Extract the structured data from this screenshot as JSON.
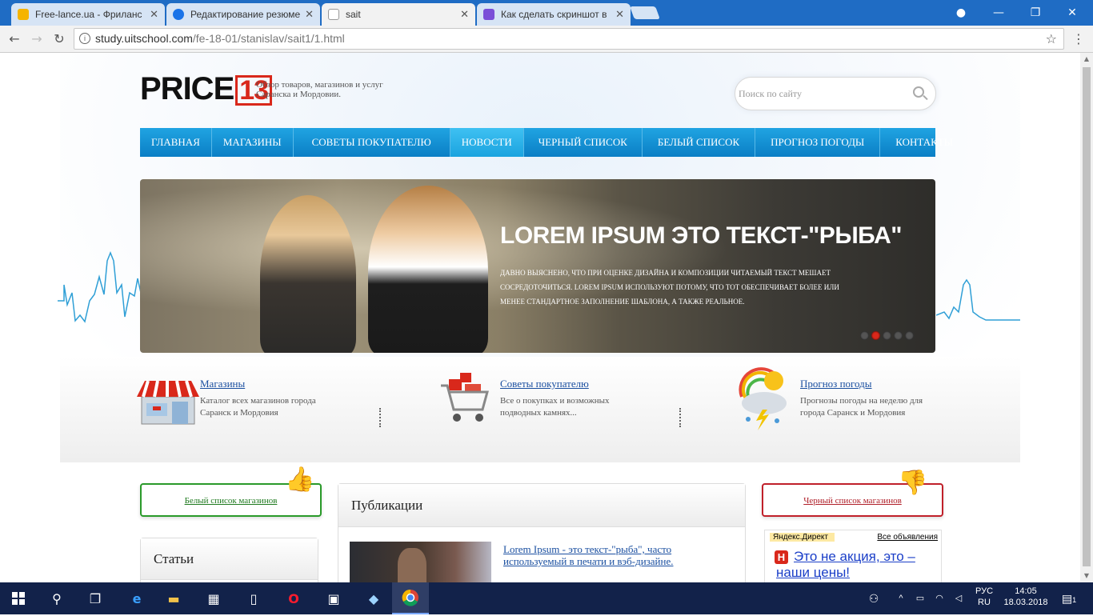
{
  "browser": {
    "tabs": [
      {
        "title": "Free-lance.ua - Фриланс",
        "favicon_color": "#f5b400"
      },
      {
        "title": "Редактирование резюме",
        "favicon_color": "#1a73e8"
      },
      {
        "title": "sait",
        "favicon_color": "#ffffff"
      },
      {
        "title": "Как сделать скриншот в",
        "favicon_color": "#7a4ed8"
      }
    ],
    "url_host": "study.uitschool.com",
    "url_path": "/fe-18-01/stanislav/sait1/1.html"
  },
  "site": {
    "logo_text": "PRICE",
    "logo_num": "13",
    "slogan": "Обзор товаров, магазинов и услуг Саранска и Мордовии.",
    "search_placeholder": "Поиск по сайту",
    "menu": [
      "ГЛАВНАЯ",
      "МАГАЗИНЫ",
      "СОВЕТЫ ПОКУПАТЕЛЮ",
      "НОВОСТИ",
      "ЧЕРНЫЙ СПИСОК",
      "БЕЛЫЙ СПИСОК",
      "ПРОГНОЗ ПОГОДЫ",
      "КОНТАКТЫ"
    ],
    "menu_active": "НОВОСТИ",
    "banner": {
      "headline": "LOREM IPSUM ЭТО ТЕКСТ-\"РЫБА\"",
      "body": "Давно выяснено, что при оценке дизайна и композиции читаемый текст мешает сосредоточиться. Lorem Ipsum используют потому, что тот обеспечивает более или менее стандартное заполнение шаблона, а также реальное.",
      "slides": 5,
      "active_slide": 2
    },
    "features": [
      {
        "title": "Магазины",
        "desc": "Каталог всех магазинов города Саранск и Мордовия"
      },
      {
        "title": "Советы покупателю",
        "desc": "Все о покупках и возможных подводных камнях..."
      },
      {
        "title": "Прогноз погоды",
        "desc": "Прогнозы погоды на неделю для города Саранск и Мордовия"
      }
    ],
    "white_list": "Белый список магазинов",
    "black_list": "Черный список магазинов",
    "articles_title": "Статьи",
    "publications_title": "Публикации",
    "publication_link": "Lorem Ipsum - это текст-\"рыба\", часто используемый в печати и вэб-дизайне.",
    "ad": {
      "brand": "Яндекс.Директ",
      "all": "Все объявления",
      "text": "Это не акция, это – наши цены!"
    },
    "colors": {
      "menu_blue": "#0a7ec5",
      "accent_red": "#d9281b",
      "white_list_green": "#2a9a2a",
      "black_list_red": "#c0202a"
    }
  },
  "taskbar": {
    "lang_top": "РУС",
    "lang_bottom": "RU",
    "time": "14:05",
    "date": "18.03.2018",
    "notifications": "1"
  }
}
